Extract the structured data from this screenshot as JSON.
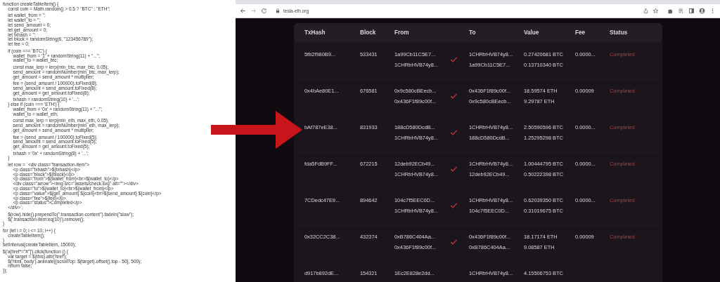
{
  "code_blocks": [
    [
      "function createTableItem() {",
      "    const coin = Math.random() > 0.5 ? \"BTC\" : \"ETH\";"
    ],
    [
      "    let wallet_from = '';",
      "    let wallet_to = '';",
      "    let send_amount = 0;",
      "    let get_amount = 0;",
      "    let txhash = '';",
      "    let block = randomString(6, \"123456789\");",
      "    let fee = 0;"
    ],
    [
      "    if (coin === 'BTC') {",
      "        wallet_from = '1' + randomString(11) + \"...\";",
      "        wallet_to = wallet_btc;"
    ],
    [
      "        const max_lerp = lerp(min_btc, max_btc, 0.05);",
      "        send_amount = randomNumber(min_btc, max_lerp);",
      "        get_amount = send_amount * multiplier;"
    ],
    [
      "        fee = (send_amount / 100000).toFixed(8);",
      "        send_amount = send_amount.toFixed(8);",
      "        get_amount = get_amount.toFixed(8);"
    ],
    [
      "        txhash = randomString(10) + '...';",
      "    } else if (coin === 'ETH') {",
      "        wallet_from = '0x' + randomString(11) + \"...\";",
      "        wallet_to = wallet_eth;"
    ],
    [
      "        const max_lerp = lerp(min_eth, max_eth, 0.05);",
      "        send_amount = randomNumber(min_eth, max_lerp);",
      "        get_amount = send_amount * multiplier;"
    ],
    [
      "        fee = (send_amount / 100000).toFixed(5);",
      "        send_amount = send_amount.toFixed(5);",
      "        get_amount = get_amount.toFixed(5);"
    ],
    [
      "        txhash = '0x' + randomString(8) + '...';",
      "    }"
    ],
    [
      "    let row = `<div class=\"transaction-item\">",
      "        <p class=\"txhash\">${txhash}</p>",
      "        <p class=\"block\">${block}</p>",
      "        <p class=\"from\">${wallet_from}<br>${wallet_to}</p>",
      "        <div class=\"arrow\"><img src=\"assets/check.svg\" alt=\"\"></div>",
      "        <p class=\"to\">${wallet_to}<br>${wallet_from}</p>",
      "        <p class=\"value\">${get_amount} ${coin}<br>${send_amount} ${coin}</p>",
      "        <p class=\"fee\">${fee}</p>",
      "        <p class=\"status\">Completed</p>",
      "    </div>`;"
    ],
    [
      "    $(row).hide().prependTo(\".transaction-content\").fadeIn(\"slow\");",
      "    $('.transaction-item:eq(10)').remove();",
      "}"
    ],
    [
      "for (let i = 0; i <= 10; i++) {",
      "    createTableItem();",
      "}",
      "setInterval(createTableItem, 15000);"
    ],
    [
      "$('a[href*=\"#\"]').click(function () {",
      "    var target = $(this).attr('href');",
      "    $('html, body').animate({scrollTop: $(target).offset().top - 50}, 500);",
      "    return false;",
      "});"
    ]
  ],
  "browser": {
    "url": "tesla-eth.org"
  },
  "table": {
    "columns": [
      "TxHash",
      "Block",
      "From",
      "To",
      "Value",
      "Fee",
      "Status"
    ],
    "rows": [
      {
        "txhash": "5fb2f980B9...",
        "block": "533431",
        "from": [
          "1a99Cb11C5E7...",
          "1CHRtrHVB74y8..."
        ],
        "to": [
          "1CHRtrHVB74y8...",
          "1a99Cb11C5E7..."
        ],
        "value": [
          "0.27420681 BTC",
          "0.13710340 BTC"
        ],
        "fee": "0.0000...",
        "status": "Completed"
      },
      {
        "txhash": "0x4bAe80E1...",
        "block": "676581",
        "from": [
          "0x9c580cBEecb...",
          "0x436F1f89c00f..."
        ],
        "to": [
          "0x436F1f89c00f...",
          "0x9c580cBEecb..."
        ],
        "value": [
          "18.59574 ETH",
          "9.29787 ETH"
        ],
        "fee": "0.00009",
        "status": "Completed"
      },
      {
        "txhash": "bAf787eE38...",
        "block": "831933",
        "from": [
          "188cD580DcdB...",
          "1CHRtrHVB74y8..."
        ],
        "to": [
          "1CHRtrHVB74y8...",
          "188cD580DcdB..."
        ],
        "value": [
          "2.50590596 BTC",
          "1.25295298 BTC"
        ],
        "fee": "0.0000...",
        "status": "Completed"
      },
      {
        "txhash": "fda5FdB9FF...",
        "block": "672215",
        "from": [
          "12deb92ECb49...",
          "1CHRtrHVB74y8..."
        ],
        "to": [
          "1CHRtrHVB74y8...",
          "12deb92ECb49..."
        ],
        "value": [
          "1.00444795 BTC",
          "0.50222398 BTC"
        ],
        "fee": "0.0000...",
        "status": "Completed"
      },
      {
        "txhash": "7CDedc47E9...",
        "block": "894642",
        "from": [
          "104c7f5EEC0D...",
          "1CHRtrHVB74y8..."
        ],
        "to": [
          "1CHRtrHVB74y8...",
          "104c7f5EEC0D..."
        ],
        "value": [
          "0.62039350 BTC",
          "0.31019675 BTC"
        ],
        "fee": "0.0000...",
        "status": "Completed"
      },
      {
        "txhash": "0x32CC2C38...",
        "block": "432374",
        "from": [
          "0xB786C404Aa...",
          "0x436F1f89c00f..."
        ],
        "to": [
          "0x436F1f89c00f...",
          "0xB786C404Aa..."
        ],
        "value": [
          "18.17174 ETH",
          "9.08587 ETH"
        ],
        "fee": "0.00009",
        "status": "Completed"
      },
      {
        "txhash": "d917b892dE...",
        "block": "154321",
        "from": [
          "1Ec2E828e2dd..."
        ],
        "to": [
          "1CHRtrHVB74y8..."
        ],
        "value": [
          "4.15506753 BTC"
        ]
      }
    ]
  }
}
